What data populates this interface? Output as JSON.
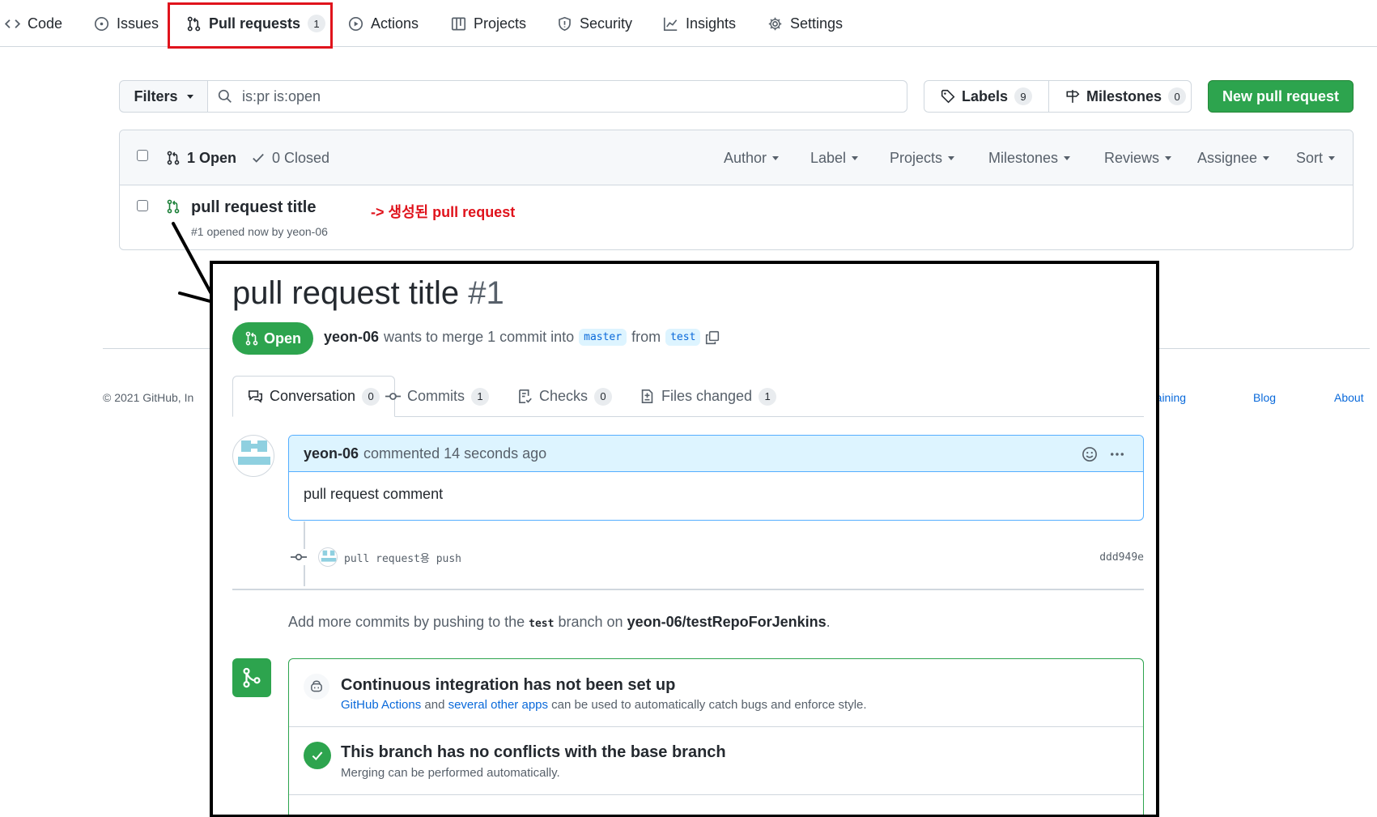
{
  "nav": {
    "items": [
      {
        "label": "Code",
        "icon": "code-icon"
      },
      {
        "label": "Issues",
        "icon": "issue-opened-icon"
      },
      {
        "label": "Pull requests",
        "icon": "git-pull-request-icon",
        "count": "1"
      },
      {
        "label": "Actions",
        "icon": "play-icon"
      },
      {
        "label": "Projects",
        "icon": "table-icon"
      },
      {
        "label": "Security",
        "icon": "shield-icon"
      },
      {
        "label": "Insights",
        "icon": "graph-icon"
      },
      {
        "label": "Settings",
        "icon": "gear-icon"
      }
    ]
  },
  "toolbar": {
    "filters_label": "Filters",
    "search_value": "is:pr is:open",
    "labels_label": "Labels",
    "labels_count": "9",
    "milestones_label": "Milestones",
    "milestones_count": "0",
    "new_pr_label": "New pull request"
  },
  "list": {
    "open_label": "1 Open",
    "closed_label": "0 Closed",
    "filters": [
      "Author",
      "Label",
      "Projects",
      "Milestones",
      "Reviews",
      "Assignee",
      "Sort"
    ],
    "row": {
      "title": "pull request title",
      "meta": "#1 opened now by yeon-06"
    }
  },
  "annotation": "-> 생성된 pull request",
  "footer": {
    "copyright": "© 2021 GitHub, In",
    "links": [
      "raining",
      "Blog",
      "About"
    ]
  },
  "pr": {
    "title": "pull request title",
    "number": "#1",
    "state": "Open",
    "author": "yeon-06",
    "merge_text": "wants to merge 1 commit into",
    "base_branch": "master",
    "from_text": "from",
    "head_branch": "test",
    "tabs": [
      {
        "label": "Conversation",
        "count": "0"
      },
      {
        "label": "Commits",
        "count": "1"
      },
      {
        "label": "Checks",
        "count": "0"
      },
      {
        "label": "Files changed",
        "count": "1"
      }
    ],
    "comment": {
      "author": "yeon-06",
      "time": "commented 14 seconds ago",
      "body": "pull request comment"
    },
    "commit": {
      "message": "pull request용 push",
      "sha": "ddd949e"
    },
    "push_hint": {
      "prefix": "Add more commits by pushing to the",
      "branch": "test",
      "middle": "branch on",
      "repo": "yeon-06/testRepoForJenkins",
      "suffix": "."
    },
    "ci": {
      "title": "Continuous integration has not been set up",
      "link1": "GitHub Actions",
      "and": "and",
      "link2": "several other apps",
      "rest": "can be used to automatically catch bugs and enforce style."
    },
    "conflicts": {
      "title": "This branch has no conflicts with the base branch",
      "sub": "Merging can be performed automatically."
    }
  },
  "colors": {
    "accent_green": "#2da44e",
    "annotation_red": "#e0131c",
    "link_blue": "#0969da"
  }
}
